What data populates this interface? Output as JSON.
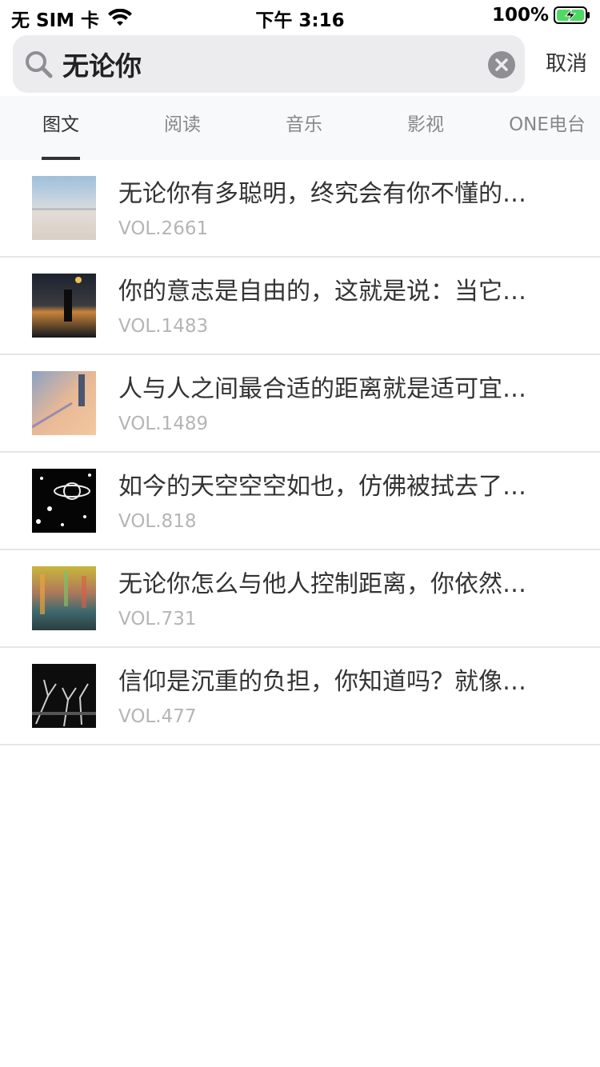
{
  "status": {
    "carrier": "无 SIM 卡",
    "time": "下午 3:16",
    "battery": "100%"
  },
  "search": {
    "query": "无论你",
    "cancel_label": "取消"
  },
  "tabs": [
    {
      "label": "图文",
      "active": true
    },
    {
      "label": "阅读",
      "active": false
    },
    {
      "label": "音乐",
      "active": false
    },
    {
      "label": "影视",
      "active": false
    },
    {
      "label": "ONE电台",
      "active": false
    }
  ],
  "results": [
    {
      "title": "无论你有多聪明，终究会有你不懂的…",
      "vol": "VOL.2661"
    },
    {
      "title": "你的意志是自由的，这就是说：当它…",
      "vol": "VOL.1483"
    },
    {
      "title": "人与人之间最合适的距离就是适可宜…",
      "vol": "VOL.1489"
    },
    {
      "title": "如今的天空空空如也，仿佛被拭去了…",
      "vol": "VOL.818"
    },
    {
      "title": "无论你怎么与他人控制距离，你依然…",
      "vol": "VOL.731"
    },
    {
      "title": "信仰是沉重的负担，你知道吗？就像…",
      "vol": "VOL.477"
    }
  ],
  "colors": {
    "accent_text": "#333333",
    "muted_text": "#b5b5b5",
    "tab_inactive": "#888888",
    "battery_green": "#4cd964"
  }
}
